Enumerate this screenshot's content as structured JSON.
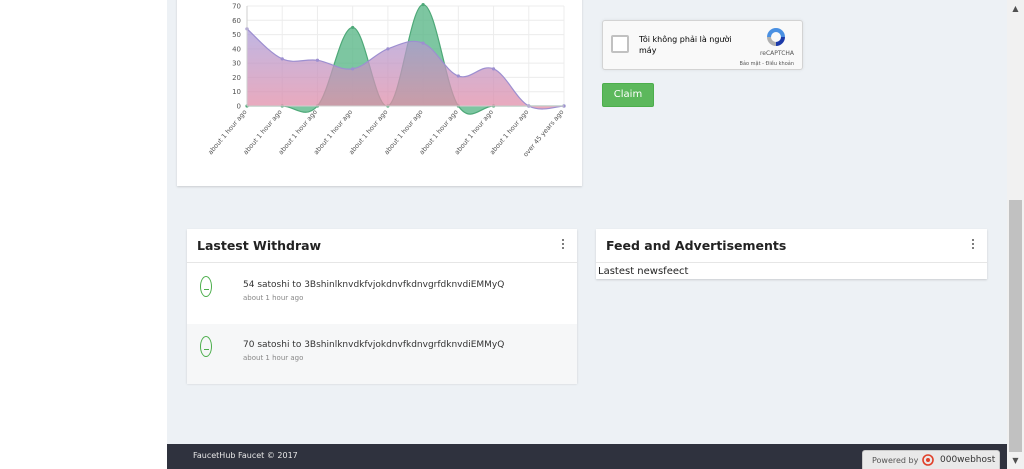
{
  "chart_data": {
    "type": "area",
    "y_ticks": [
      "0",
      "10",
      "20",
      "30",
      "40",
      "50",
      "60",
      "70"
    ],
    "ylim": [
      0,
      70
    ],
    "x_labels": [
      "about 1 hour ago",
      "about 1 hour ago",
      "about 1 hour ago",
      "about 1 hour ago",
      "about 1 hour ago",
      "about 1 hour ago",
      "about 1 hour ago",
      "about 1 hour ago",
      "about 1 hour ago",
      "over 45 years ago"
    ],
    "series": [
      {
        "color": "#a78bd6",
        "values": [
          54,
          33,
          32,
          26,
          40,
          44,
          21,
          26,
          0,
          0
        ]
      },
      {
        "color": "#5cb88a",
        "values": [
          0,
          0,
          0,
          55,
          0,
          71,
          0,
          0,
          0,
          0
        ]
      }
    ],
    "grid": true
  },
  "captcha": {
    "label": "Tôi không phải là người máy",
    "brand": "reCAPTCHA",
    "terms": "Bảo mật - Điều khoản"
  },
  "claim": {
    "label": "Claim"
  },
  "withdraw": {
    "title": "Lastest Withdraw",
    "items": [
      {
        "text": "54 satoshi to 3BshinlknvdkfvjokdnvfkdnvgrfdknvdiEMMyQ",
        "time": "about 1 hour ago"
      },
      {
        "text": "70 satoshi to 3BshinlknvdkfvjokdnvfkdnvgrfdknvdiEMMyQ",
        "time": "about 1 hour ago"
      }
    ]
  },
  "feed": {
    "title": "Feed and Advertisements",
    "newsfeed": "Lastest newsfeect"
  },
  "footer": {
    "copyright": "FaucetHub Faucet © 2017"
  },
  "powered": {
    "label": "Powered by",
    "host": "000webhost"
  },
  "colors": {
    "accent": "#5cb85c",
    "footer": "#2f323e",
    "background": "#edf1f5"
  }
}
